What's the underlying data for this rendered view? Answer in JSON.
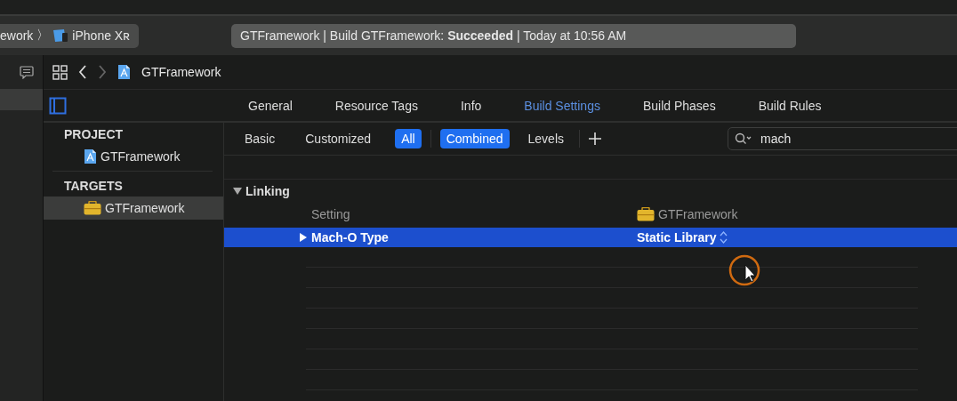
{
  "toolbar": {
    "scheme": "ework",
    "separator": "〉",
    "device": "iPhone Xʀ",
    "status": "GTFramework | Build GTFramework: **Succeeded** | Today at 10:56 AM"
  },
  "jump_bar": {
    "item": "GTFramework"
  },
  "tabs": [
    {
      "label": "General",
      "selected": false
    },
    {
      "label": "Resource Tags",
      "selected": false
    },
    {
      "label": "Info",
      "selected": false
    },
    {
      "label": "Build Settings",
      "selected": true
    },
    {
      "label": "Build Phases",
      "selected": false
    },
    {
      "label": "Build Rules",
      "selected": false
    }
  ],
  "sidebar": {
    "sections": [
      {
        "title": "PROJECT",
        "items": [
          {
            "label": "GTFramework",
            "kind": "project",
            "selected": false
          }
        ]
      },
      {
        "title": "TARGETS",
        "items": [
          {
            "label": "GTFramework",
            "kind": "target",
            "selected": true
          }
        ]
      }
    ]
  },
  "filters": [
    {
      "label": "Basic",
      "selected": false
    },
    {
      "label": "Customized",
      "selected": false
    },
    {
      "label": "All",
      "selected": true
    }
  ],
  "view_modes": [
    {
      "label": "Combined",
      "selected": true
    },
    {
      "label": "Levels",
      "selected": false
    }
  ],
  "search": {
    "value": "mach"
  },
  "settings": {
    "section": {
      "title": "Linking",
      "expanded": true
    },
    "columns": [
      "Setting",
      "GTFramework"
    ],
    "rows": [
      {
        "name": "Mach-O Type",
        "value": "Static Library",
        "selected": true,
        "expanded": false
      }
    ]
  }
}
